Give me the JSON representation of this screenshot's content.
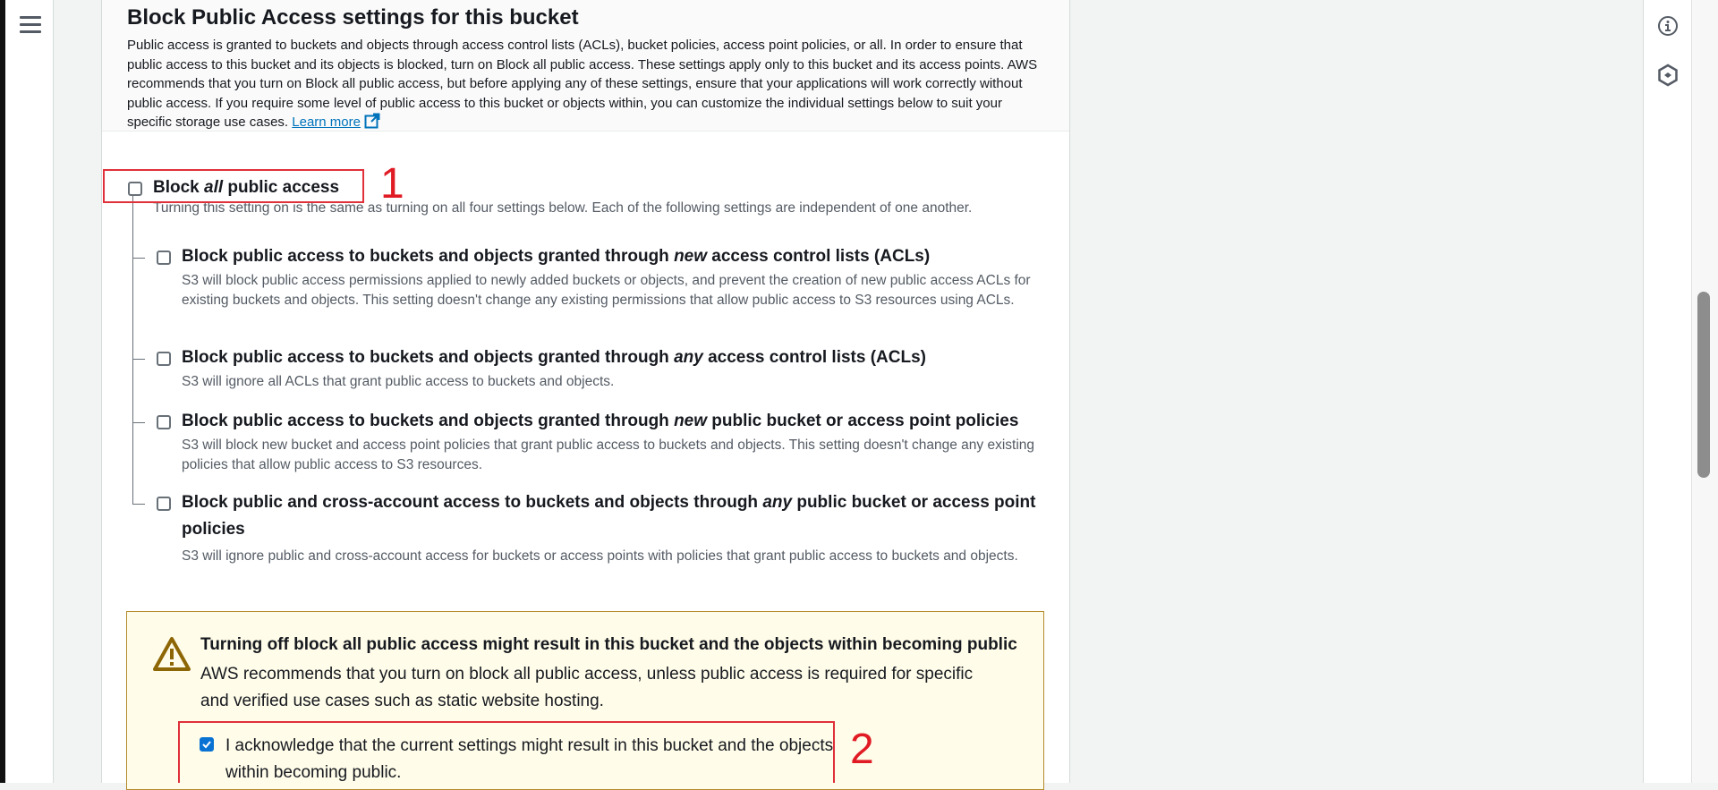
{
  "section": {
    "title": "Block Public Access settings for this bucket",
    "description": "Public access is granted to buckets and objects through access control lists (ACLs), bucket policies, access point policies, or all. In order to ensure that public access to this bucket and its objects is blocked, turn on Block all public access. These settings apply only to this bucket and its access points. AWS recommends that you turn on Block all public access, but before applying any of these settings, ensure that your applications will work correctly without public access. If you require some level of public access to this bucket or objects within, you can customize the individual settings below to suit your specific storage use cases.",
    "learn_more": "Learn more"
  },
  "block_all": {
    "title_pre": "Block ",
    "title_em": "all",
    "title_post": " public access",
    "checked": false,
    "description": "Turning this setting on is the same as turning on all four settings below. Each of the following settings are independent of one another."
  },
  "options": [
    {
      "title_pre": "Block public access to buckets and objects granted through ",
      "title_em": "new",
      "title_post": " access control lists (ACLs)",
      "checked": false,
      "description": "S3 will block public access permissions applied to newly added buckets or objects, and prevent the creation of new public access ACLs for existing buckets and objects. This setting doesn't change any existing permissions that allow public access to S3 resources using ACLs."
    },
    {
      "title_pre": "Block public access to buckets and objects granted through ",
      "title_em": "any",
      "title_post": " access control lists (ACLs)",
      "checked": false,
      "description": "S3 will ignore all ACLs that grant public access to buckets and objects."
    },
    {
      "title_pre": "Block public access to buckets and objects granted through ",
      "title_em": "new",
      "title_post": " public bucket or access point policies",
      "checked": false,
      "description": "S3 will block new bucket and access point policies that grant public access to buckets and objects. This setting doesn't change any existing policies that allow public access to S3 resources."
    },
    {
      "title_pre": "Block public and cross-account access to buckets and objects through ",
      "title_em": "any",
      "title_post": " public bucket or access point policies",
      "checked": false,
      "description": "S3 will ignore public and cross-account access for buckets or access points with policies that grant public access to buckets and objects."
    }
  ],
  "warning": {
    "title": "Turning off block all public access might result in this bucket and the objects within becoming public",
    "text": "AWS recommends that you turn on block all public access, unless public access is required for specific and verified use cases such as static website hosting.",
    "ack_label": "I acknowledge that the current settings might result in this bucket and the objects within becoming public.",
    "ack_checked": true
  },
  "annotations": {
    "first": "1",
    "second": "2"
  },
  "icons": {
    "nav": "hamburger-menu-icon",
    "info": "info-icon",
    "tools": "hexagon-settings-icon",
    "warning": "warning-triangle-icon",
    "external": "external-link-icon"
  },
  "colors": {
    "link": "#0073bb",
    "checkbox_checked": "#0972d3",
    "annotation": "#e01b24",
    "warning_bg": "#fffce9",
    "warning_border": "#b58a2f"
  }
}
